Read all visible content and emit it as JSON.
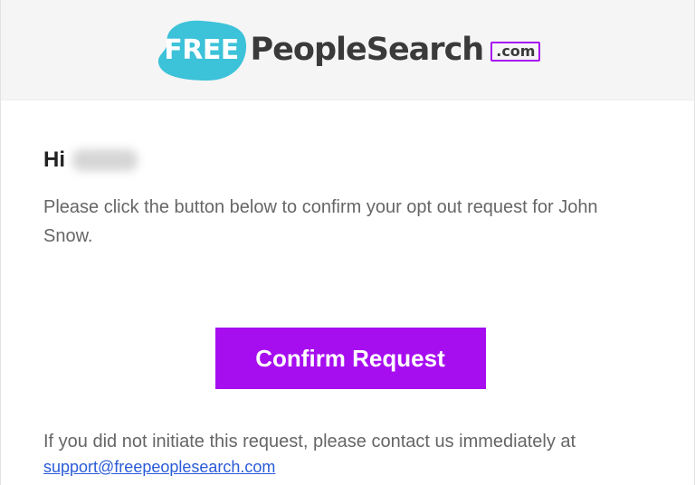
{
  "header": {
    "logo": {
      "free_text": "FREE",
      "name_text": "PeopleSearch",
      "tld_text": ".com",
      "blob_color": "#3cc2d9",
      "tld_border_color": "#a60ef0"
    }
  },
  "email": {
    "greeting": "Hi",
    "recipient_name": "",
    "message": "Please click the button below to confirm your opt out request for John Snow.",
    "confirm_button_label": "Confirm Request",
    "footer_note": "If you did not initiate this request, please contact us immediately at",
    "support_email": "support@freepeoplesearch.com"
  },
  "colors": {
    "accent": "#a60ef0",
    "link": "#2a5bd7",
    "text": "#666666",
    "heading": "#222222",
    "header_bg": "#f5f5f5"
  }
}
